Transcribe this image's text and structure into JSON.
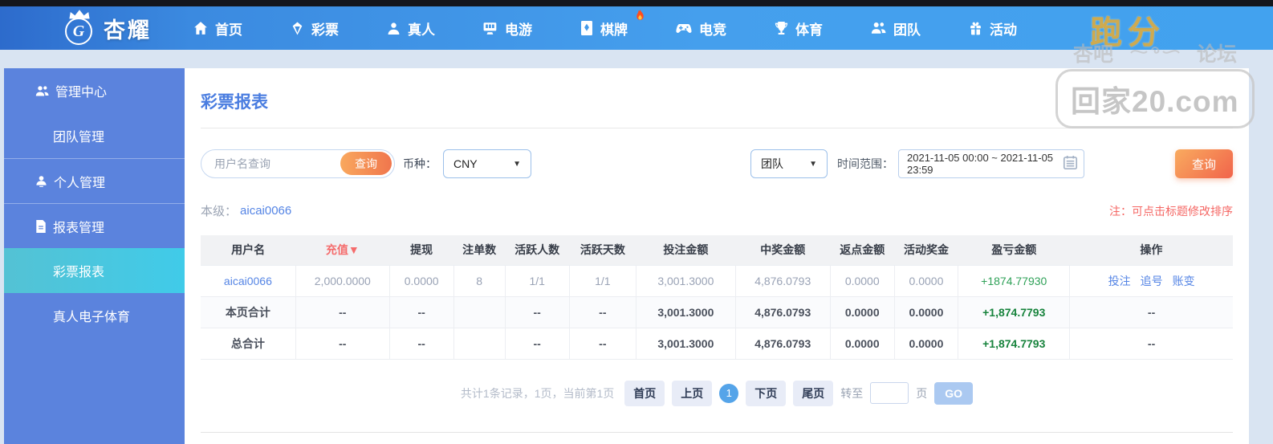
{
  "colors": {
    "nav_blue": "#3f96e8",
    "sidebar_blue": "#5b83dd",
    "active_item_cyan": "#49c6df",
    "accent_orange": "#f2854f",
    "link_blue": "#5585e5",
    "danger_red": "#f56c6c",
    "profit_green": "#17833c"
  },
  "nav": {
    "logo_text": "杏耀",
    "logo_monogram": "G",
    "items": [
      {
        "label": "首页",
        "icon": "home-icon"
      },
      {
        "label": "彩票",
        "icon": "lottery-icon"
      },
      {
        "label": "真人",
        "icon": "live-icon"
      },
      {
        "label": "电游",
        "icon": "egame-icon"
      },
      {
        "label": "棋牌",
        "icon": "chess-icon",
        "badge": "flame"
      },
      {
        "label": "电竞",
        "icon": "esports-icon"
      },
      {
        "label": "体育",
        "icon": "sports-icon"
      },
      {
        "label": "团队",
        "icon": "team-icon"
      },
      {
        "label": "活动",
        "icon": "activity-icon"
      }
    ]
  },
  "watermarks": {
    "runfen": "跑分",
    "forum_left": "杏吧",
    "forum_right": "论坛",
    "site": "回家20.com"
  },
  "sidebar": {
    "items": [
      {
        "label": "管理中心"
      },
      {
        "label": "团队管理"
      },
      {
        "label": "个人管理"
      },
      {
        "label": "报表管理"
      },
      {
        "label": "彩票报表"
      },
      {
        "label": "真人电子体育"
      }
    ]
  },
  "main": {
    "title": "彩票报表",
    "filters": {
      "username_placeholder": "用户名查询",
      "inline_search_label": "查询",
      "currency_label": "币种：",
      "currency_value": "CNY",
      "scope_value": "团队",
      "range_label": "时间范围：",
      "range_value": "2021-11-05 00:00 ~ 2021-11-05 23:59",
      "query_label": "查询",
      "select_caret": "▼"
    },
    "level_label": "本级：",
    "level_value": "aicai0066",
    "sort_note": "注：可点击标题修改排序",
    "table": {
      "headers": [
        "用户名",
        "充值",
        "提现",
        "注单数",
        "活跃人数",
        "活跃天数",
        "投注金额",
        "中奖金额",
        "返点金额",
        "活动奖金",
        "盈亏金额",
        "操作"
      ],
      "sort_indicator": "▼",
      "rows": [
        {
          "cells": [
            "aicai0066",
            "2,000.0000",
            "0.0000",
            "8",
            "1/1",
            "1/1",
            "3,001.3000",
            "4,876.0793",
            "0.0000",
            "0.0000",
            "+1874.77930"
          ],
          "actions": [
            "投注",
            "追号",
            "账变"
          ]
        }
      ],
      "totals": [
        {
          "label": "本页合计",
          "cells": [
            "--",
            "--",
            "",
            "--",
            "--",
            "3,001.3000",
            "4,876.0793",
            "0.0000",
            "0.0000",
            "+1,874.7793"
          ],
          "actions": "--"
        },
        {
          "label": "总合计",
          "cells": [
            "--",
            "--",
            "",
            "--",
            "--",
            "3,001.3000",
            "4,876.0793",
            "0.0000",
            "0.0000",
            "+1,874.7793"
          ],
          "actions": "--"
        }
      ]
    },
    "pagination": {
      "summary": "共计1条记录，1页，当前第1页",
      "first": "首页",
      "prev": "上页",
      "current": "1",
      "next": "下页",
      "last": "尾页",
      "goto_label": "转至",
      "unit_label": "页",
      "go_label": "GO"
    }
  }
}
